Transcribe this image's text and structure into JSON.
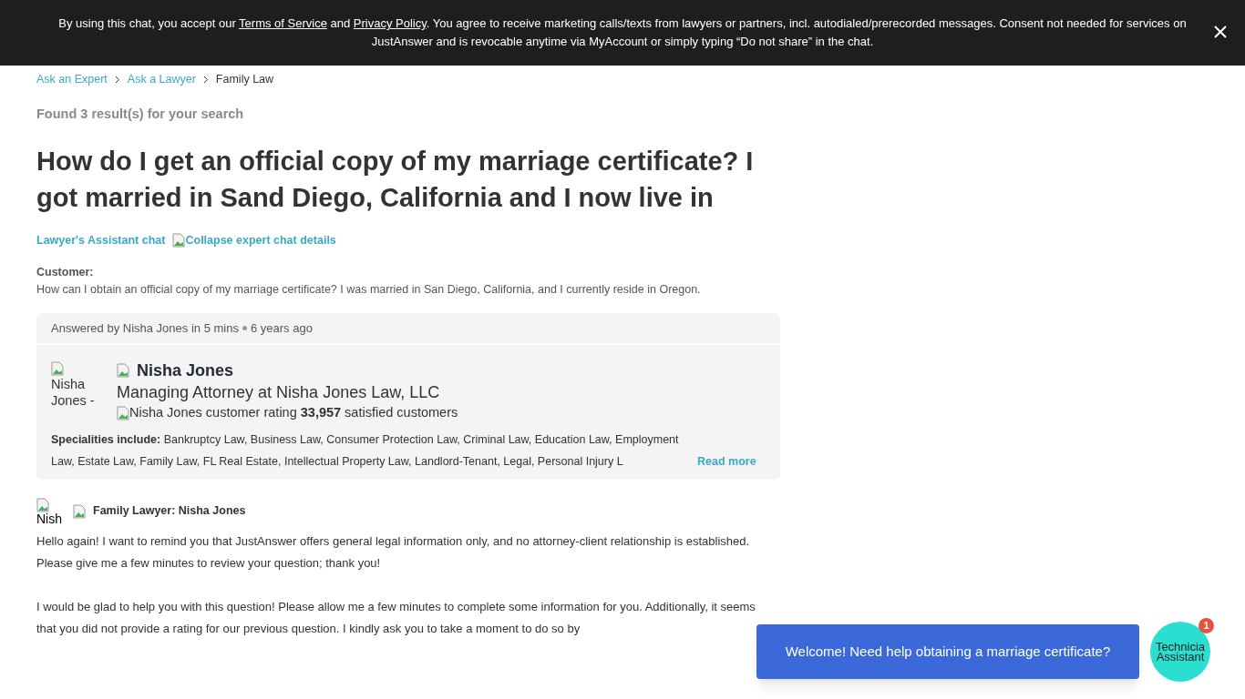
{
  "consent_banner": {
    "before": "By using this chat, you accept our ",
    "link_1": "Terms of Service",
    "middle": " and ",
    "link_2": "Privacy Policy",
    "after": ". You agree to receive marketing calls/texts from lawyers or partners, incl. autodialed/prerecorded messages. Consent not needed for services on JustAnswer and is revocable anytime via MyAccount or simply typing “Do not share” in the chat."
  },
  "breadcrumbs": [
    {
      "label": "Ask an Expert",
      "link": true
    },
    {
      "label": "Ask a Lawyer",
      "link": true
    },
    {
      "label": "Family Law",
      "link": false
    }
  ],
  "results_count": "Found 3 result(s) for your search",
  "question_title": "How do I get an official copy of my marriage certificate? I got married in Sand Diego, California and I now live in",
  "chat_link": "Lawyer's Assistant chat",
  "collapse_link": "Collapse expert chat details",
  "customer": {
    "label": "Customer:",
    "text": "How can I obtain an official copy of my marriage certificate? I was married in San Diego, California, and I currently reside in Oregon."
  },
  "answer_card": {
    "answered_by": "Answered by Nisha Jones in 5 mins",
    "time": "6 years ago",
    "avatar_alt": "Nisha Jones -",
    "name": "Nisha Jones",
    "title": "Managing Attorney at Nisha Jones Law, LLC",
    "rating_alt": "Nisha Jones customer rating",
    "satisfied_count": "33,957",
    "satisfied_label": "satisfied customers",
    "specialities_label": "Specialities include:",
    "specialities": "Bankruptcy Law, Business Law, Consumer Protection Law, Criminal Law, Education Law, Employment Law, Estate Law, Family Law, FL Real Estate, Intellectual Property Law, Landlord-Tenant, Legal, Personal Injury L",
    "read_more": "Read more"
  },
  "message": {
    "avatar_alt": "Nish",
    "author": "Family Lawyer: Nisha Jones",
    "paragraphs": [
      "Hello again! I want to remind you that JustAnswer offers general legal information only, and no attorney-client relationship is established. Please give me a few minutes to review your question; thank you!",
      "I would be glad to help you with this question! Please allow me a few minutes to complete some information for you. Additionally, it seems that you did not provide a rating for our previous question. I kindly ask you to take a moment to do so by"
    ]
  },
  "chat_widget": {
    "bubble": "Welcome! Need help obtaining a marriage certificate?",
    "avatar_alt": "Technicia Assistant",
    "badge": "1"
  }
}
